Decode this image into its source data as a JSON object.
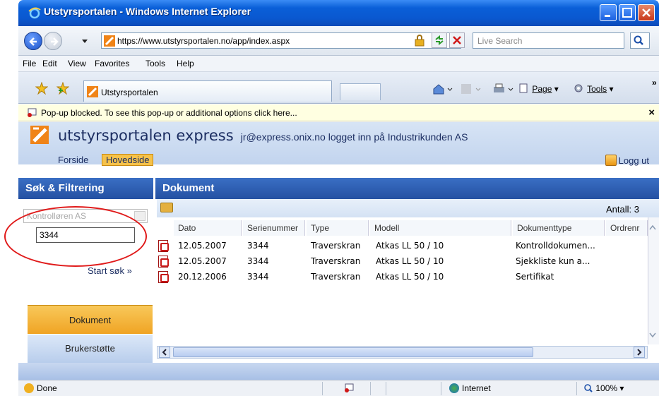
{
  "window": {
    "title": "Utstyrsportalen - Windows Internet Explorer"
  },
  "address": {
    "url": "https://www.utstyrsportalen.no/app/index.aspx",
    "search_placeholder": "Live Search"
  },
  "menu": {
    "items": [
      "File",
      "Edit",
      "View",
      "Favorites",
      "Tools",
      "Help"
    ]
  },
  "tabs": {
    "active_label": "Utstyrsportalen",
    "page_label": "Page",
    "tools_label": "Tools"
  },
  "popup": {
    "message": "Pop-up blocked. To see this pop-up or additional options click here...",
    "close": "×"
  },
  "app": {
    "brand": "utstyrsportalen express",
    "user_info": "jr@express.onix.no logget inn på Industrikunden AS",
    "nav": [
      "Forside",
      "Hovedside"
    ],
    "logout_label": "Logg ut"
  },
  "filter": {
    "heading": "Søk & Filtrering",
    "select_value": "Kontrolløren AS",
    "search_value": "3344",
    "start_label": "Start søk »"
  },
  "sidebar_buttons": {
    "dokument": "Dokument",
    "brukerstotte": "Brukerstøtte"
  },
  "documents": {
    "heading": "Dokument",
    "count_label": "Antall: 3",
    "columns": [
      "Dato",
      "Serienummer",
      "Type",
      "Modell",
      "Dokumenttype",
      "Ordrenr"
    ],
    "rows": [
      [
        "12.05.2007",
        "3344",
        "Traverskran",
        "Atkas LL 50 / 10",
        "Kontrolldokumen..."
      ],
      [
        "12.05.2007",
        "3344",
        "Traverskran",
        "Atkas LL 50 / 10",
        "Sjekkliste kun a..."
      ],
      [
        "20.12.2006",
        "3344",
        "Traverskran",
        "Atkas LL 50 / 10",
        "Sertifikat"
      ]
    ]
  },
  "status": {
    "text": "Done",
    "zone": "Internet",
    "zoom": "100%"
  }
}
